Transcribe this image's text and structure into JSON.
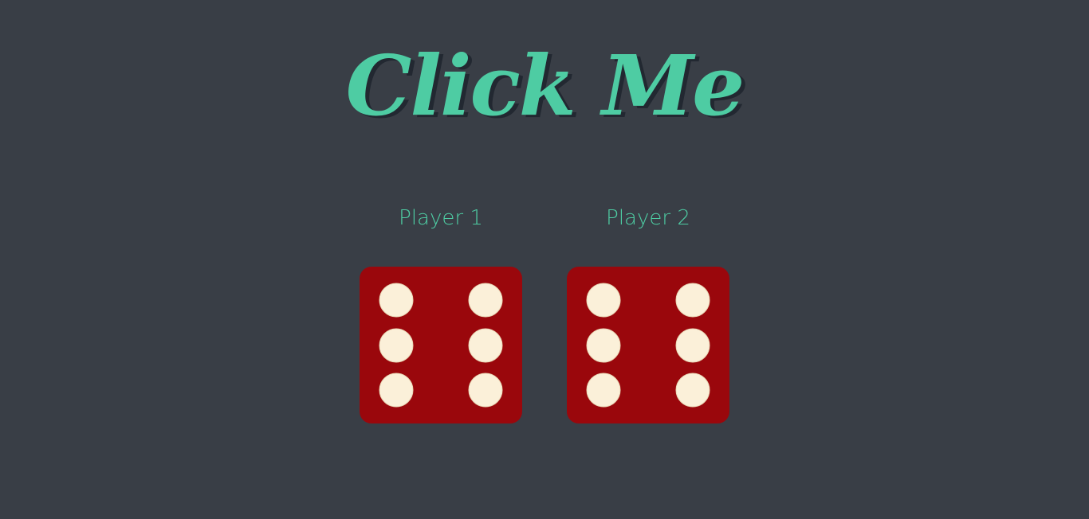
{
  "title": "Click Me",
  "players": [
    {
      "label": "Player 1",
      "die_value": 6
    },
    {
      "label": "Player 2",
      "die_value": 6
    }
  ],
  "colors": {
    "background": "#393e46",
    "accent": "#4ecca3",
    "die_face": "#9a070c",
    "pip": "#fbf0d9",
    "title_shadow": "#222831"
  }
}
